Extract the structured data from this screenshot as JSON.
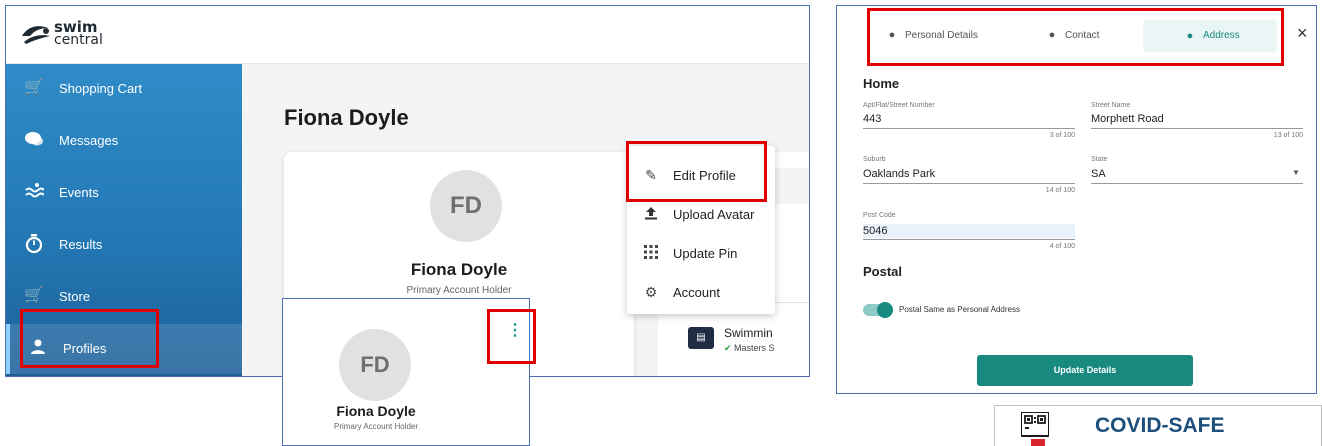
{
  "app": {
    "logo": {
      "line1": "swim",
      "line2": "central"
    },
    "sidebar": {
      "items": [
        {
          "label": "Shopping Cart",
          "icon": "cart-icon"
        },
        {
          "label": "Messages",
          "icon": "chat-icon"
        },
        {
          "label": "Events",
          "icon": "pool-icon"
        },
        {
          "label": "Results",
          "icon": "stopwatch-icon"
        },
        {
          "label": "Store",
          "icon": "store-cart-icon"
        },
        {
          "label": "Profiles",
          "icon": "person-icon",
          "active": true
        }
      ]
    },
    "main": {
      "title": "Fiona Doyle",
      "card": {
        "initials": "FD",
        "name": "Fiona Doyle",
        "subtitle": "Primary Account Holder"
      },
      "right_panel": {
        "status_fragment": "atus",
        "membership": "Swimmin",
        "membership_status": "Masters S"
      },
      "menu": [
        {
          "label": "Edit Profile",
          "icon": "pencil-icon"
        },
        {
          "label": "Upload Avatar",
          "icon": "upload-icon"
        },
        {
          "label": "Update Pin",
          "icon": "keypad-icon"
        },
        {
          "label": "Account",
          "icon": "gear-icon"
        }
      ]
    }
  },
  "zoom_card": {
    "initials": "FD",
    "name": "Fiona Doyle",
    "subtitle": "Primary Account Holder",
    "menu_glyph": "⋮"
  },
  "dialog": {
    "tabs": [
      {
        "label": "Personal Details",
        "active": false
      },
      {
        "label": "Contact",
        "active": false
      },
      {
        "label": "Address",
        "active": true
      }
    ],
    "close": "×",
    "home": {
      "heading": "Home",
      "apt_label": "Apt/Flat/Street Number",
      "apt_value": "443",
      "apt_count": "3 of 100",
      "street_label": "Street Name",
      "street_value": "Morphett Road",
      "street_count": "13 of 100",
      "suburb_label": "Suburb",
      "suburb_value": "Oaklands Park",
      "suburb_count": "14 of 100",
      "state_label": "State",
      "state_value": "SA",
      "postcode_label": "Post Code",
      "postcode_value": "5046",
      "postcode_count": "4 of 100"
    },
    "postal": {
      "heading": "Postal",
      "toggle_label": "Postal Same as Personal Address",
      "toggle_on": true
    },
    "update_button": "Update Details"
  },
  "badge": {
    "text": "COVID-SAFE"
  },
  "colors": {
    "accent": "#17897f",
    "sidebar": "#2378b4",
    "highlight": "#e00000",
    "frame": "#4a6fb5"
  }
}
